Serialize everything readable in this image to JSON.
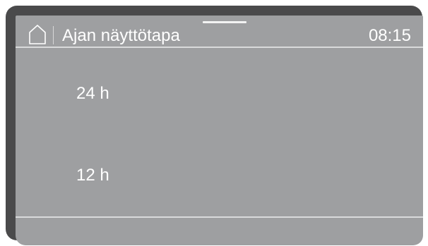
{
  "header": {
    "title": "Ajan näyttötapa",
    "time": "08:15",
    "home_icon": "home-icon"
  },
  "options": [
    {
      "label": "24 h"
    },
    {
      "label": "12 h"
    }
  ],
  "colors": {
    "bezel": "#4a4a4b",
    "screen": "#9e9fa1",
    "text": "#ffffff",
    "divider": "#d9dadb"
  }
}
